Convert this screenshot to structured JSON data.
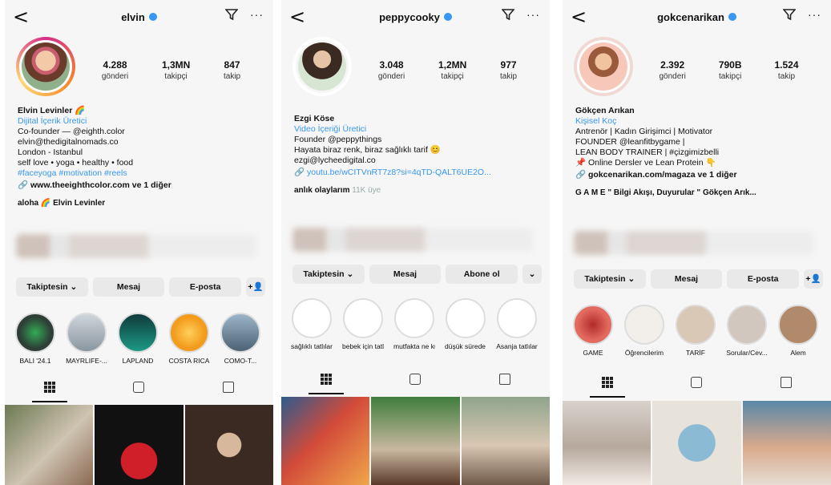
{
  "panels": [
    {
      "username": "elvin",
      "stats": [
        {
          "n": "4.288",
          "l": "gönderi"
        },
        {
          "n": "1,3MN",
          "l": "takipçi"
        },
        {
          "n": "847",
          "l": "takip"
        }
      ],
      "name": "Elvin Levinler 🌈",
      "category": "Dijital İçerik Üretici",
      "bio": [
        "Co-founder — @eighth.color",
        "elvin@thedigitalnomads.co",
        "London - Istanbul",
        "self love • yoga • healthy • food"
      ],
      "hashtags": "#faceyoga #motivation #reels",
      "link": "www.theeighthcolor.com ve 1 diğer",
      "channels": "aloha 🌈   Elvin Levinler",
      "buttons": [
        "Takiptesin ⌄",
        "Mesaj",
        "E-posta",
        "+👤"
      ],
      "highlights": [
        "BALI '24.1",
        "MAYRLIFE-...",
        "LAPLAND",
        "COSTA RICA",
        "COMO-T..."
      ]
    },
    {
      "username": "peppycooky",
      "stats": [
        {
          "n": "3.048",
          "l": "gönderi"
        },
        {
          "n": "1,2MN",
          "l": "takipçi"
        },
        {
          "n": "977",
          "l": "takip"
        }
      ],
      "name": "Ezgi Köse",
      "category": "Video İçeriği Üretici",
      "bio": [
        "Founder @peppythings",
        "Hayata biraz renk, biraz sağlıklı tarif 😊",
        "ezgi@lycheedigital.co"
      ],
      "link": "youtu.be/wCITVnRT7z8?si=4qTD-QALT6UE2O...",
      "channels": "anlık olaylarım",
      "channels_sub": "11K üye",
      "buttons": [
        "Takiptesin ⌄",
        "Mesaj",
        "Abone ol",
        "⌄"
      ],
      "highlights": [
        "sağlıklı tatlılar",
        "bebek için tatlılar",
        "mutfakta ne kullanıyorum",
        "düşük sürede sağlıklı",
        "Asanja tatlılar"
      ]
    },
    {
      "username": "gokcenarikan",
      "stats": [
        {
          "n": "2.392",
          "l": "gönderi"
        },
        {
          "n": "790B",
          "l": "takipçi"
        },
        {
          "n": "1.524",
          "l": "takip"
        }
      ],
      "name": "Gökçen Arıkan",
      "category": "Kişisel Koç",
      "bio": [
        "Antrenör | Kadın Girişimci | Motivator",
        "FOUNDER @leanfitbygame |",
        "LEAN BODY TRAINER | #çizgimizbelli",
        "📌 Online Dersler ve Lean Protein 👇"
      ],
      "link": "gokcenarikan.com/magaza ve 1 diğer",
      "channels": "G A M E \" Bilgi Akışı, Duyurular \"   Gökçen Arık...",
      "buttons": [
        "Takiptesin ⌄",
        "Mesaj",
        "E-posta",
        "+👤"
      ],
      "highlights": [
        "GAME",
        "Öğrencilerim",
        "TARİF",
        "Sorular/Cev...",
        "Alem"
      ]
    }
  ],
  "tabs": [
    "grid-icon",
    "reels-icon",
    "tagged-icon"
  ]
}
